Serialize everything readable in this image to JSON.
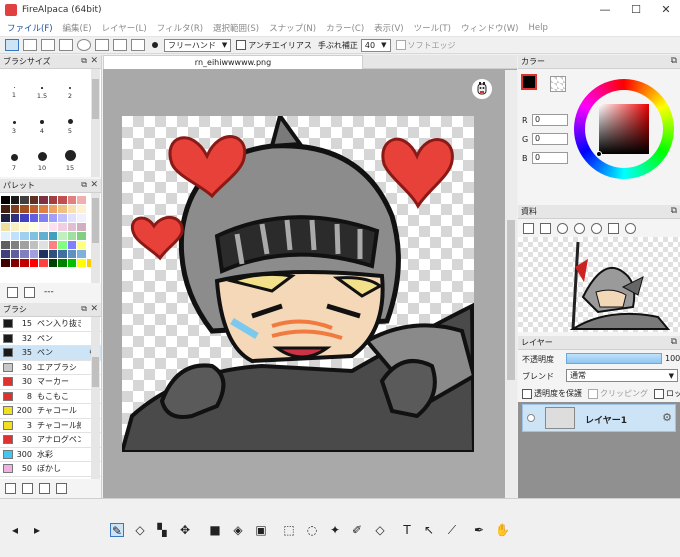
{
  "titlebar": {
    "title": "FireAlpaca (64bit)",
    "minimize": "—",
    "maximize": "☐",
    "close": "✕"
  },
  "menu": [
    "ファイル(F)",
    "編集(E)",
    "レイヤー(L)",
    "フィルタ(R)",
    "選択範囲(S)",
    "スナップ(N)",
    "カラー(C)",
    "表示(V)",
    "ツール(T)",
    "ウィンドウ(W)",
    "Help"
  ],
  "toolbar": {
    "brush_mode": "フリーハンド",
    "antialias_label": "アンチエイリアス",
    "stabilizer_label": "手ぶれ補正",
    "stabilizer_value": "40",
    "soft_edge_label": "ソフトエッジ"
  },
  "brush_size_panel": {
    "title": "ブラシサイズ",
    "sizes": [
      "1",
      "1.5",
      "2",
      "3",
      "4",
      "5",
      "7",
      "10",
      "15"
    ]
  },
  "palette_panel": {
    "title": "パレット",
    "footer_text": "---",
    "colors": [
      "#000000",
      "#1a1a1a",
      "#404040",
      "#603020",
      "#803040",
      "#a04040",
      "#c05050",
      "#e08080",
      "#f0b0b0",
      "#ffffff",
      "#402010",
      "#804020",
      "#a05020",
      "#c06030",
      "#e08040",
      "#f0a060",
      "#f0c080",
      "#f8e0b0",
      "#fff0d0",
      "#ffffff",
      "#202040",
      "#303080",
      "#4040c0",
      "#6060e0",
      "#8080f0",
      "#a0a0f8",
      "#c0c0ff",
      "#e0e0ff",
      "#f0f0ff",
      "#ffffff",
      "#f0e0a0",
      "#f8f0c0",
      "#fff8d0",
      "#ffffe0",
      "#fff0f0",
      "#ffe0f0",
      "#f0d0e0",
      "#e0c0d0",
      "#d0b0c0",
      "#ffffff",
      "#e0f0ff",
      "#c0e0ff",
      "#a0d0f0",
      "#80c0e0",
      "#60b0d0",
      "#40a0c0",
      "#c0f0c0",
      "#a0e0a0",
      "#80d080",
      "#ffffff",
      "#606060",
      "#808080",
      "#a0a0a0",
      "#c0c0c0",
      "#e0e0e0",
      "#ff8080",
      "#80ff80",
      "#8080ff",
      "#ffff80",
      "#ffffff",
      "#404080",
      "#6060a0",
      "#8080c0",
      "#a0a0e0",
      "#203060",
      "#305080",
      "#4070a0",
      "#6090c0",
      "#80b0e0",
      "#ffffff",
      "#400000",
      "#800000",
      "#c00000",
      "#ff0000",
      "#ff4040",
      "#004000",
      "#008000",
      "#00c000",
      "#ffff00",
      "#ffcc00"
    ]
  },
  "brush_panel": {
    "title": "ブラシ",
    "items": [
      {
        "size": "15",
        "name": "ペン入り抜き",
        "color": "#1a1a1a"
      },
      {
        "size": "32",
        "name": "ペン",
        "color": "#1a1a1a"
      },
      {
        "size": "35",
        "name": "ペン",
        "color": "#1a1a1a",
        "selected": true
      },
      {
        "size": "30",
        "name": "エアブラシ",
        "color": "#c8c8c8"
      },
      {
        "size": "30",
        "name": "マーカー",
        "color": "#e03030"
      },
      {
        "size": "8",
        "name": "もこもこ",
        "color": "#e03030"
      },
      {
        "size": "200",
        "name": "チャコール",
        "color": "#f0e020"
      },
      {
        "size": "3",
        "name": "チャコール線",
        "color": "#f0e020"
      },
      {
        "size": "30",
        "name": "アナログペン(",
        "color": "#e03030"
      },
      {
        "size": "300",
        "name": "水彩",
        "color": "#40c8f0"
      },
      {
        "size": "50",
        "name": "ぼかし",
        "color": "#f0b0e0"
      }
    ]
  },
  "document": {
    "tab_name": "rn_eihiwwwww.png"
  },
  "color_panel": {
    "title": "カラー",
    "r_label": "R",
    "g_label": "G",
    "b_label": "B",
    "r": "0",
    "g": "0",
    "b": "0"
  },
  "material_panel": {
    "title": "資料"
  },
  "layer_panel": {
    "title": "レイヤー",
    "opacity_label": "不透明度",
    "opacity_value": "100",
    "blend_label": "ブレンド",
    "blend_mode": "通常",
    "lock_alpha_label": "透明度を保護",
    "clipping_label": "クリッピング",
    "lock_label": "ロック",
    "layers": [
      {
        "name": "レイヤー1",
        "visible": true
      }
    ]
  },
  "colors": {
    "foreground": "#000000",
    "accent": "#3b78c2",
    "selection": "#cde4f7"
  }
}
